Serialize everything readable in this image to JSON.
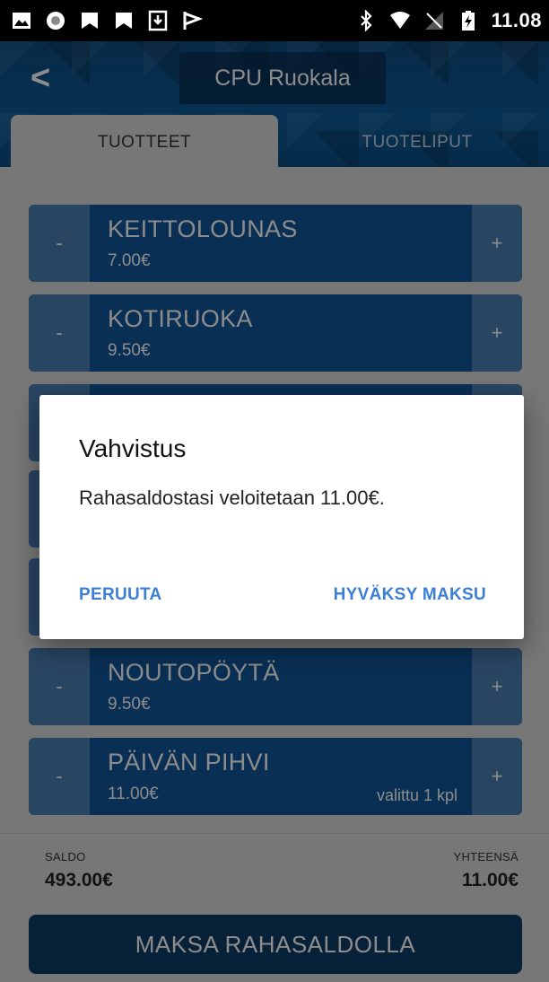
{
  "status_bar": {
    "time": "11.08",
    "left_icons": [
      "image-icon",
      "record-icon",
      "bookmark-icon",
      "bookmark-icon",
      "download-icon",
      "flag-icon"
    ],
    "right_icons": [
      "bluetooth-icon",
      "wifi-icon",
      "no-signal-icon",
      "battery-charging-icon"
    ]
  },
  "header": {
    "back_label": "<",
    "title": "CPU Ruokala",
    "tabs": [
      {
        "label": "TUOTTEET",
        "active": true
      },
      {
        "label": "TUOTELIPUT",
        "active": false
      }
    ]
  },
  "products": [
    {
      "name": "KEITTOLOUNAS",
      "price": "7.00€",
      "selected": "",
      "minus": "-",
      "plus": "+"
    },
    {
      "name": "KOTIRUOKA",
      "price": "9.50€",
      "selected": "",
      "minus": "-",
      "plus": "+"
    },
    {
      "name": "",
      "price": "",
      "selected": "",
      "minus": "-",
      "plus": "+"
    },
    {
      "name": "",
      "price": "",
      "selected": "",
      "minus": "-",
      "plus": "+"
    },
    {
      "name": "",
      "price": "",
      "selected": "",
      "minus": "-",
      "plus": "+"
    },
    {
      "name": "NOUTOPÖYTÄ",
      "price": "9.50€",
      "selected": "",
      "minus": "-",
      "plus": "+"
    },
    {
      "name": "PÄIVÄN PIHVI",
      "price": "11.00€",
      "selected": "valittu 1 kpl",
      "minus": "-",
      "plus": "+"
    }
  ],
  "footer": {
    "saldo_label": "SALDO",
    "saldo_value": "493.00€",
    "total_label": "YHTEENSÄ",
    "total_value": "11.00€",
    "pay_button": "MAKSA RAHASALDOLLA"
  },
  "dialog": {
    "title": "Vahvistus",
    "message": "Rahasaldostasi veloitetaan 11.00€.",
    "cancel_button": "PERUUTA",
    "accept_button": "HYVÄKSY MAKSU"
  },
  "colors": {
    "accent_blue": "#12579a",
    "dialog_button": "#3c7fd6",
    "pay_button": "#0d3c68"
  }
}
